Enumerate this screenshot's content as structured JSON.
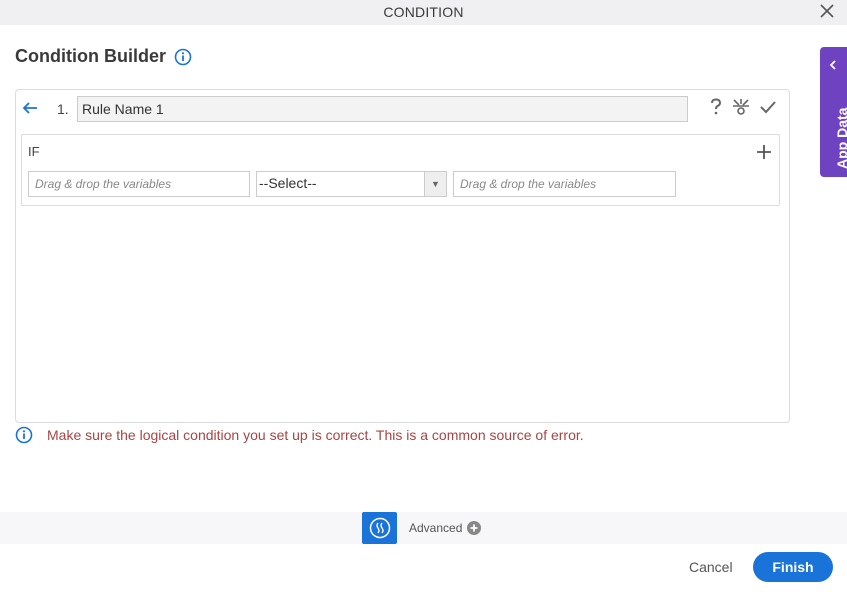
{
  "window": {
    "title": "CONDITION",
    "close_icon": "close-icon"
  },
  "heading": {
    "title": "Condition Builder",
    "info_icon": "info-icon"
  },
  "rule": {
    "number": "1.",
    "name": "Rule Name 1",
    "icons": [
      "help-icon",
      "bug-icon",
      "check-icon"
    ]
  },
  "condition": {
    "if_label": "IF",
    "left_placeholder": "Drag & drop the variables",
    "operator_selected": "--Select--",
    "right_placeholder": "Drag & drop the variables"
  },
  "warning": {
    "text": "Make sure the logical condition you set up is correct. This is a common source of error."
  },
  "app_data": {
    "label": "App Data"
  },
  "advanced": {
    "label": "Advanced"
  },
  "footer": {
    "cancel_label": "Cancel",
    "finish_label": "Finish"
  },
  "colors": {
    "primary": "#1a73d9",
    "app_data": "#6f42c1",
    "warning": "#a94442"
  }
}
